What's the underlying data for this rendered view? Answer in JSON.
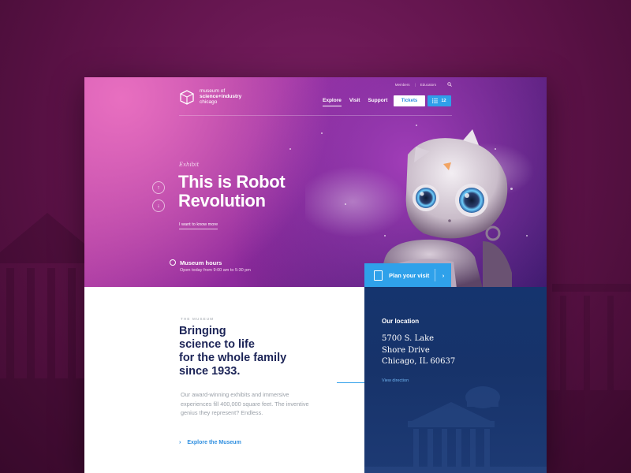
{
  "site": {
    "logo_line1": "museum of",
    "logo_line2": "science+industry",
    "logo_line3": "chicago"
  },
  "utility": {
    "members": "Members",
    "educators": "Educators"
  },
  "nav": {
    "items": [
      {
        "label": "Explore",
        "active": true
      },
      {
        "label": "Visit"
      },
      {
        "label": "Support"
      }
    ]
  },
  "tickets_label": "Tickets",
  "cart_count": "12",
  "hero": {
    "eyebrow": "Exhibit",
    "headline_line1": "This is Robot",
    "headline_line2": "Revolution",
    "more_link": "I want to know more",
    "hours_title": "Museum hours",
    "hours_text": "Open today from 9:00 am to 5:30 pm",
    "plan_visit": "Plan your visit"
  },
  "museum": {
    "kicker": "THE MUSEUM",
    "headline_lines": [
      "Bringing",
      "science to life",
      "for the whole family",
      "since 1933."
    ],
    "paragraph": "Our award-winning exhibits and immersive experiences fill 400,000 square feet. The inventive genius they represent? Endless.",
    "explore_link": "Explore the Museum"
  },
  "location": {
    "title": "Our location",
    "address_lines": [
      "5700 S. Lake",
      "Shore Drive",
      "Chicago, IL 60637"
    ],
    "view_direction": "View direction"
  },
  "colors": {
    "accent": "#2f9fea",
    "navy": "#1c2457",
    "purple": "#8e2a9c"
  }
}
